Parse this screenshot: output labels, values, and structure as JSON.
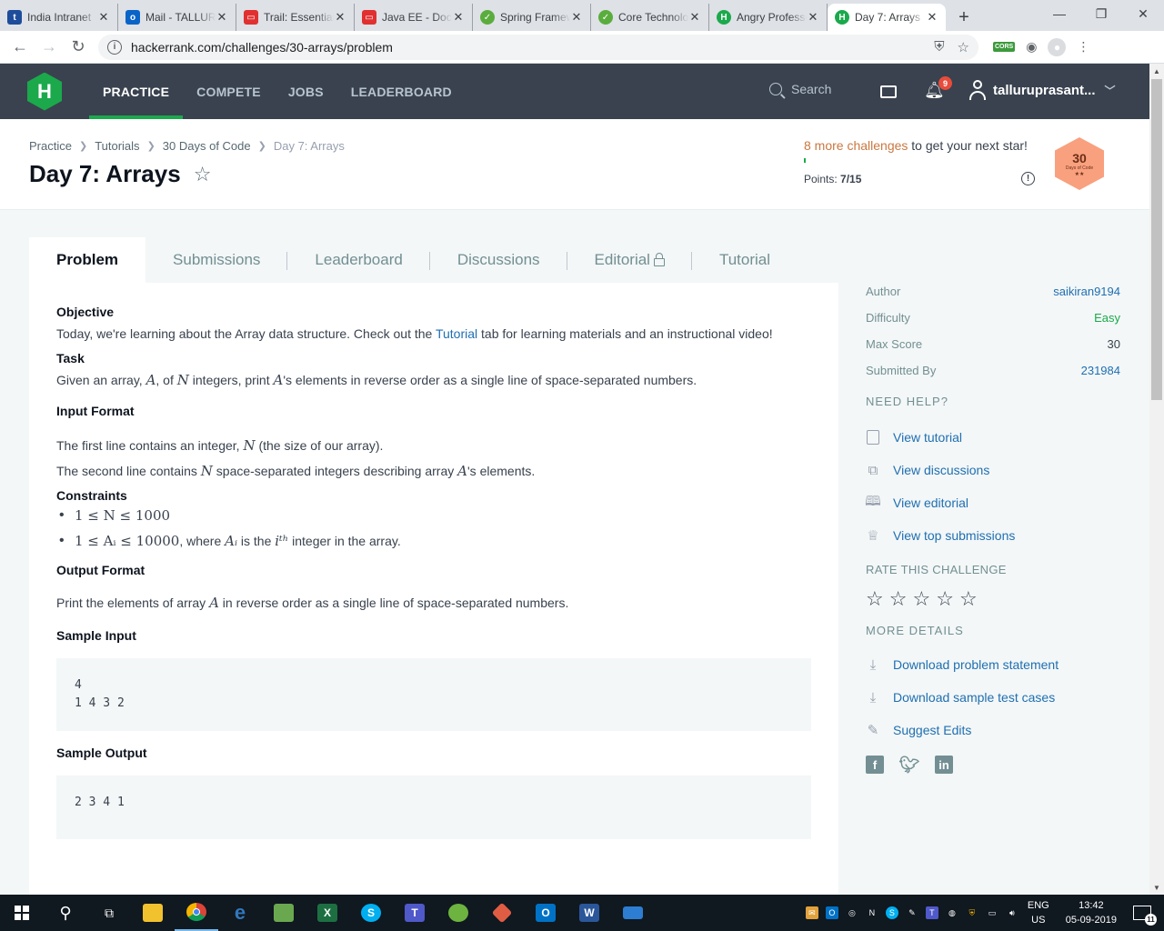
{
  "browser": {
    "tabs": [
      {
        "title": "India Intranet",
        "icon_letter": "t",
        "icon_color": "#1e4d9b"
      },
      {
        "title": "Mail - TALLURI",
        "icon_letter": "o",
        "icon_color": "#0a64c8"
      },
      {
        "title": "Trail: Essential",
        "icon_letter": "▭",
        "icon_color": "#e03030"
      },
      {
        "title": "Java EE - Docs",
        "icon_letter": "▭",
        "icon_color": "#e03030"
      },
      {
        "title": "Spring Framework",
        "icon_letter": "✓",
        "icon_color": "#5aad3d"
      },
      {
        "title": "Core Technologies",
        "icon_letter": "✓",
        "icon_color": "#5aad3d"
      },
      {
        "title": "Angry Professor",
        "icon_letter": "H",
        "icon_color": "#1ba94c"
      },
      {
        "title": "Day 7: Arrays",
        "icon_letter": "H",
        "icon_color": "#1ba94c"
      }
    ],
    "url": "hackerrank.com/challenges/30-arrays/problem",
    "ext_cors": "CORS"
  },
  "nav": {
    "logo": "H",
    "links": [
      "PRACTICE",
      "COMPETE",
      "JOBS",
      "LEADERBOARD"
    ],
    "search_placeholder": "Search",
    "notifications": "9",
    "username": "talluruprasant..."
  },
  "header": {
    "breadcrumb": [
      "Practice",
      "Tutorials",
      "30 Days of Code",
      "Day 7: Arrays"
    ],
    "title": "Day 7: Arrays",
    "progress_link": "8 more challenges",
    "progress_rest": " to get your next star!",
    "points_label": "Points: ",
    "points_value": "7/15",
    "points_fraction": 0.0,
    "badge_num": "30",
    "badge_sub": "Days of Code",
    "badge_stars": "★★"
  },
  "tabs": [
    "Problem",
    "Submissions",
    "Leaderboard",
    "Discussions",
    "Editorial",
    "Tutorial"
  ],
  "problem": {
    "objective_h": "Objective",
    "objective_p1": "Today, we're learning about the Array data structure. Check out the ",
    "objective_link": "Tutorial",
    "objective_p2": " tab for learning materials and an instructional video!",
    "task_h": "Task",
    "task_p1": "Given an array, ",
    "task_A": "A",
    "task_p2": ", of ",
    "task_N": "N",
    "task_p3": " integers, print ",
    "task_p4": "'s elements in reverse order as a single line of space-separated numbers.",
    "input_h": "Input Format",
    "input_l1a": "The first line contains an integer, ",
    "input_l1b": " (the size of our array).",
    "input_l2a": "The second line contains ",
    "input_l2b": " space-separated integers describing array ",
    "input_l2c": "'s elements.",
    "constraints_h": "Constraints",
    "c1": "1 ≤ N ≤ 1000",
    "c2_math": "1 ≤ Aᵢ ≤ 10000",
    "c2_text1": ", where ",
    "c2_Ai": "Aᵢ",
    "c2_text2": " is the ",
    "c2_ith": "iᵗʰ",
    "c2_text3": " integer in the array.",
    "output_h": "Output Format",
    "output_p1": "Print the elements of array ",
    "output_p2": " in reverse order as a single line of space-separated numbers.",
    "sample_in_h": "Sample Input",
    "sample_in_l1": "4",
    "sample_in_l2": "1 4 3 2",
    "sample_out_h": "Sample Output",
    "sample_out": "2 3 4 1"
  },
  "sidebar": {
    "meta": [
      {
        "label": "Author",
        "value": "saikiran9194"
      },
      {
        "label": "Difficulty",
        "value": "Easy"
      },
      {
        "label": "Max Score",
        "value": "30"
      },
      {
        "label": "Submitted By",
        "value": "231984"
      }
    ],
    "need_help_h": "NEED HELP?",
    "help": [
      "View tutorial",
      "View discussions",
      "View editorial",
      "View top submissions"
    ],
    "rate_h": "RATE THIS CHALLENGE",
    "more_h": "MORE DETAILS",
    "more": [
      "Download problem statement",
      "Download sample test cases",
      "Suggest Edits"
    ]
  },
  "taskbar": {
    "lang1": "ENG",
    "lang2": "US",
    "time": "13:42",
    "date": "05-09-2019",
    "notif_count": "11"
  }
}
